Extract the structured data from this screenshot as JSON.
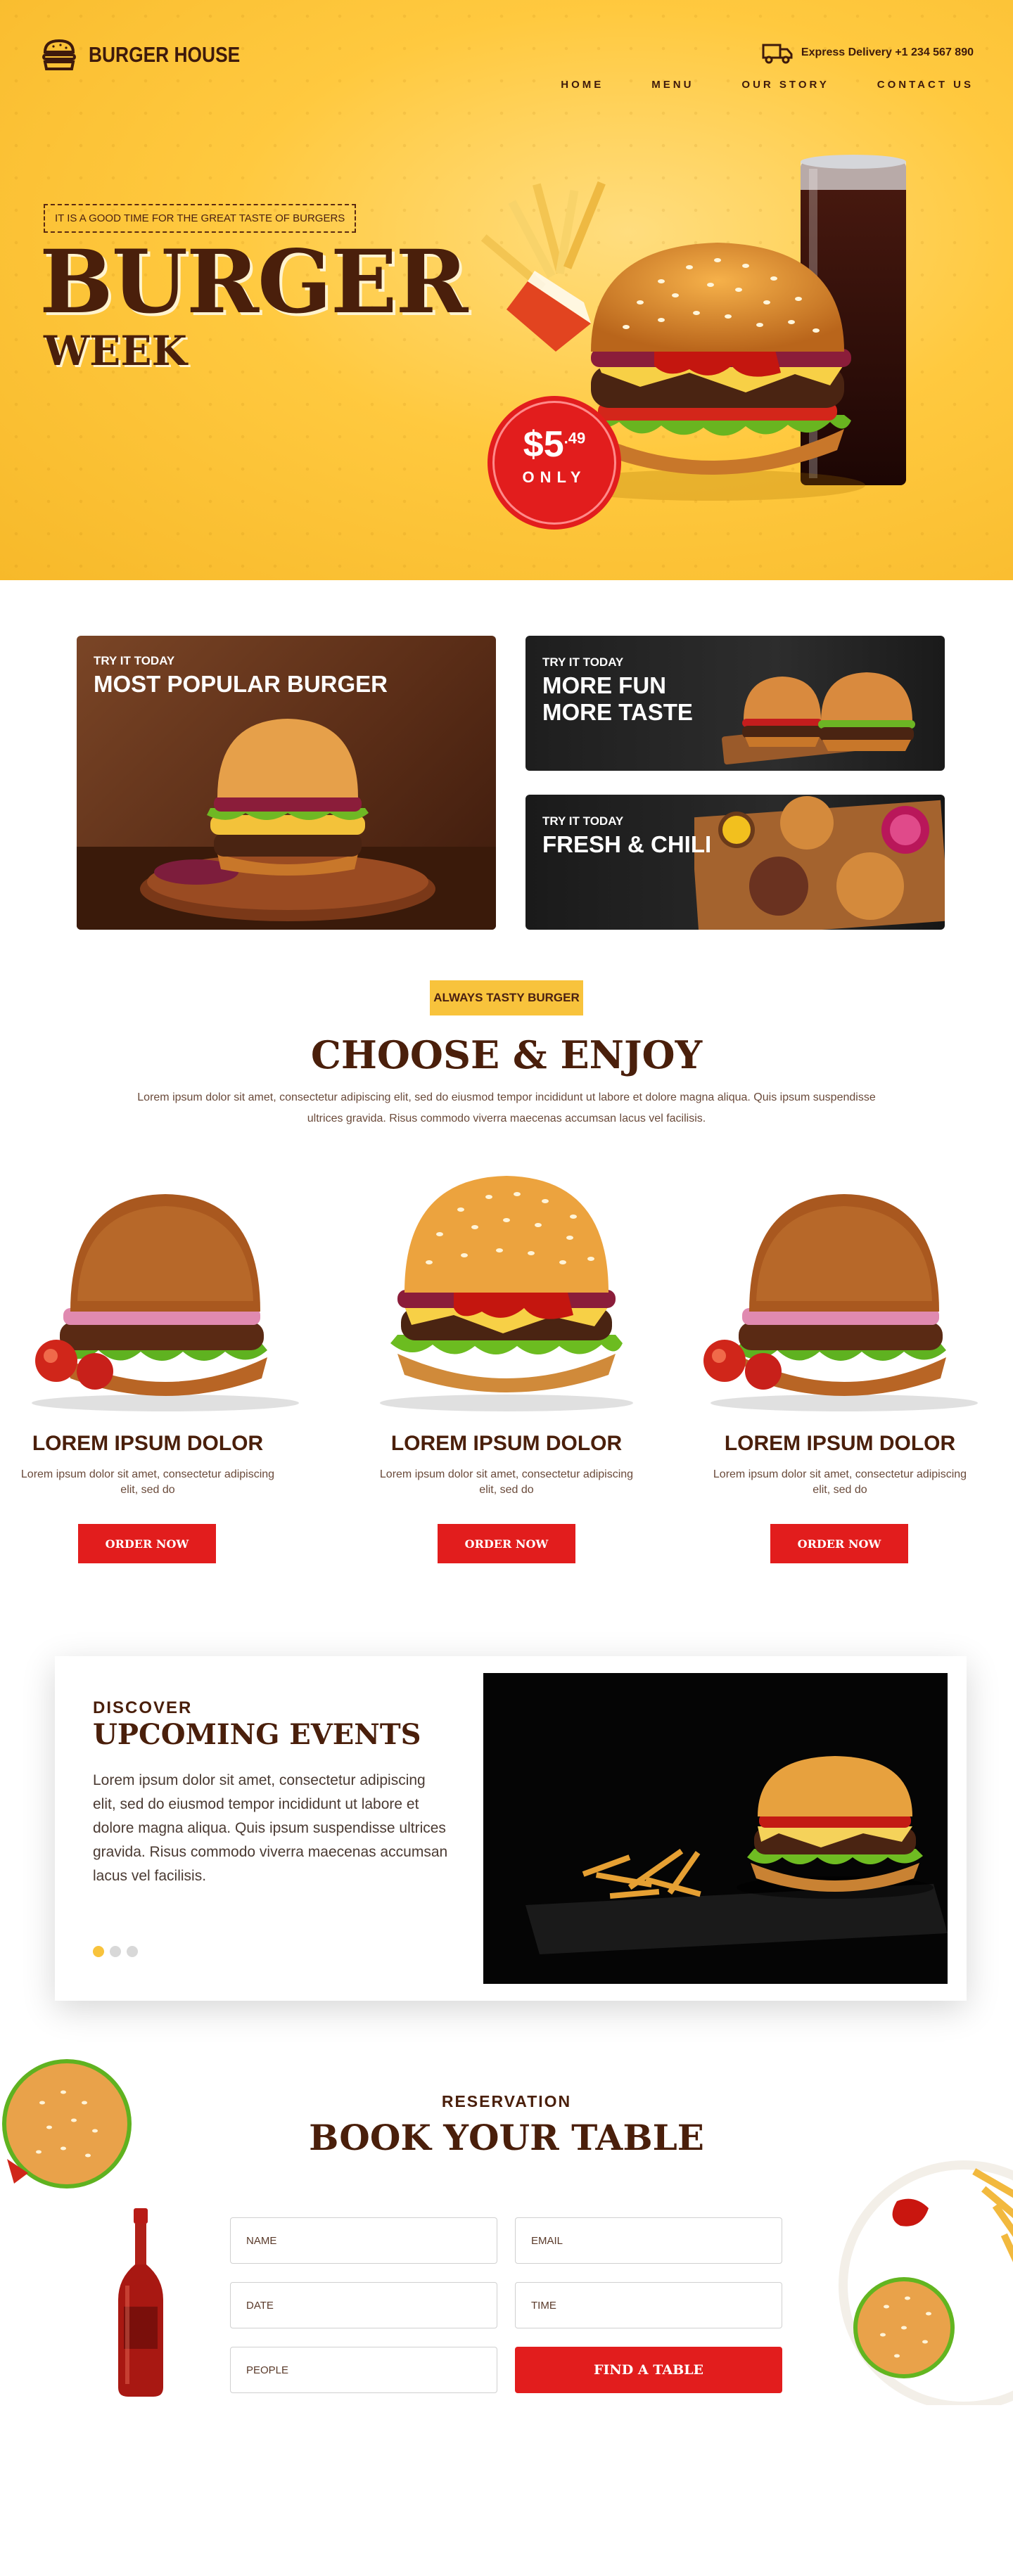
{
  "brand": {
    "name": "BURGER HOUSE",
    "logo_icon": "burger-logo-icon"
  },
  "header": {
    "delivery_text": "Express Delivery +1 234 567 890",
    "delivery_icon": "delivery-truck-icon",
    "nav": [
      "HOME",
      "MENU",
      "OUR STORY",
      "CONTACT US"
    ]
  },
  "hero": {
    "tagline": "IT IS A GOOD TIME FOR THE GREAT TASTE OF BURGERS",
    "title": "BURGER",
    "subtitle": "WEEK",
    "price_dollars": "$5",
    "price_cents": ".49",
    "price_only": "ONLY"
  },
  "promos": [
    {
      "pre": "TRY IT TODAY",
      "title": "MOST POPULAR BURGER"
    },
    {
      "pre": "TRY IT TODAY",
      "title": "MORE FUN",
      "title2": "MORE TASTE"
    },
    {
      "pre": "TRY IT TODAY",
      "title": "FRESH & CHILI"
    }
  ],
  "choose": {
    "pill": "ALWAYS TASTY BURGER",
    "heading": "CHOOSE & ENJOY",
    "lead": "Lorem ipsum dolor sit amet, consectetur adipiscing elit, sed do eiusmod tempor incididunt ut labore et dolore magna aliqua. Quis ipsum suspendisse ultrices gravida. Risus commodo viverra maecenas accumsan lacus vel facilisis."
  },
  "products": [
    {
      "name": "LOREM IPSUM DOLOR",
      "desc": "Lorem ipsum dolor sit amet, consectetur adipiscing elit, sed do",
      "button": "ORDER NOW"
    },
    {
      "name": "LOREM IPSUM DOLOR",
      "desc": "Lorem ipsum dolor sit amet, consectetur adipiscing elit, sed do",
      "button": "ORDER NOW"
    },
    {
      "name": "LOREM IPSUM DOLOR",
      "desc": "Lorem ipsum dolor sit amet, consectetur adipiscing elit, sed do",
      "button": "ORDER NOW"
    }
  ],
  "events": {
    "pre": "DISCOVER",
    "heading": "UPCOMING EVENTS",
    "text": "Lorem ipsum dolor sit amet, consectetur adipiscing elit, sed do eiusmod tempor incididunt ut labore et dolore magna aliqua. Quis ipsum suspendisse ultrices gravida. Risus commodo viverra maecenas accumsan lacus vel facilisis.",
    "slides": 3,
    "active_slide": 1
  },
  "reservation": {
    "pre": "RESERVATION",
    "heading": "BOOK YOUR TABLE",
    "name_placeholder": "NAME",
    "email_placeholder": "EMAIL",
    "date_placeholder": "DATE",
    "time_placeholder": "TIME",
    "people_placeholder": "PEOPLE",
    "submit": "FIND A TABLE"
  },
  "colors": {
    "accent_red": "#e21d1d",
    "accent_yellow": "#f8c33c",
    "brown": "#4a1f0b"
  }
}
